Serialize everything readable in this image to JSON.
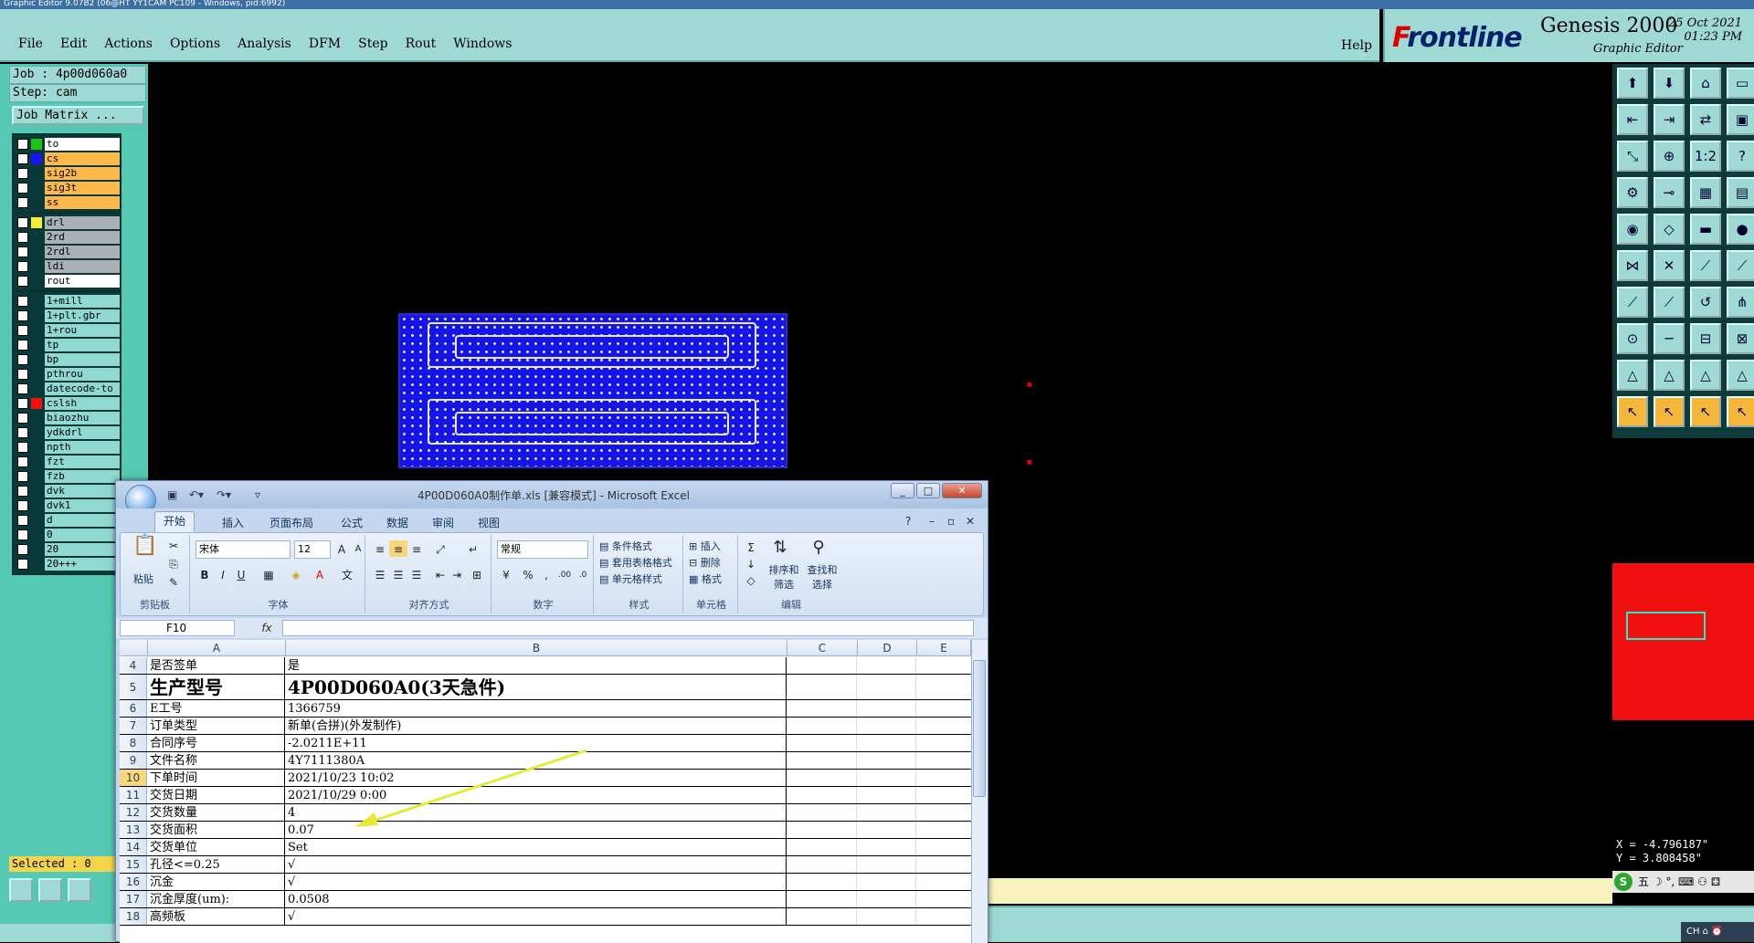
{
  "window_title": "Graphic Editor 9.07B2 (06@HT YY1CAM PC109 - Windows, pid:6992)",
  "menu": [
    "File",
    "Edit",
    "Actions",
    "Options",
    "Analysis",
    "DFM",
    "Step",
    "Rout",
    "Windows"
  ],
  "help": "Help",
  "brand": {
    "logo_f": "F",
    "logo_rest": "rontline",
    "title": "Genesis 2000",
    "subtitle": "Graphic Editor",
    "date": "25 Oct 2021",
    "time": "01:23 PM"
  },
  "job": "Job : 4p00d060a0",
  "step": "Step: cam",
  "job_matrix": "Job Matrix ...",
  "layers_board": [
    {
      "name": "to",
      "color": "#1cc41c",
      "kind": "top"
    },
    {
      "name": "cs",
      "color": "#1616f0",
      "kind": "board"
    },
    {
      "name": "sig2b",
      "color": "",
      "kind": "board"
    },
    {
      "name": "sig3t",
      "color": "",
      "kind": "board"
    },
    {
      "name": "ss",
      "color": "",
      "kind": "board"
    }
  ],
  "layers_drill": [
    {
      "name": "drl",
      "color": "#f5ef3c",
      "kind": "drill"
    },
    {
      "name": "2rd",
      "color": "",
      "kind": "drill"
    },
    {
      "name": "2rdl",
      "color": "",
      "kind": "drill"
    },
    {
      "name": "ldi",
      "color": "",
      "kind": "drill"
    },
    {
      "name": "rout",
      "color": "",
      "kind": "drillw"
    }
  ],
  "layers_misc": [
    {
      "name": "1+mill",
      "color": ""
    },
    {
      "name": "1+plt.gbr",
      "color": ""
    },
    {
      "name": "1+rou",
      "color": ""
    },
    {
      "name": "tp",
      "color": ""
    },
    {
      "name": "bp",
      "color": ""
    },
    {
      "name": "pthrou",
      "color": ""
    },
    {
      "name": "datecode-to",
      "color": ""
    },
    {
      "name": "cslsh",
      "color": "#f01010"
    },
    {
      "name": "biaozhu",
      "color": ""
    },
    {
      "name": "ydkdrl",
      "color": ""
    },
    {
      "name": "npth",
      "color": ""
    },
    {
      "name": "fzt",
      "color": ""
    },
    {
      "name": "fzb",
      "color": ""
    },
    {
      "name": "dvk",
      "color": ""
    },
    {
      "name": "dvk1",
      "color": ""
    },
    {
      "name": "d",
      "color": ""
    },
    {
      "name": "0",
      "color": ""
    },
    {
      "name": "20",
      "color": ""
    },
    {
      "name": "20+++",
      "color": ""
    }
  ],
  "selected": "Selected : 0",
  "coords": {
    "x": "X = -4.796187\"",
    "y": "Y = 3.808458\""
  },
  "ime": "五 ☽ °, ⌨ ⚇ ⚃",
  "tray": "CH ⌂ ⏰",
  "excel": {
    "title": "4P00D060A0制作单.xls [兼容模式] - Microsoft Excel",
    "tabs": [
      "开始",
      "插入",
      "页面布局",
      "公式",
      "数据",
      "审阅",
      "视图"
    ],
    "groups": {
      "clipboard": "剪贴板",
      "font": "字体",
      "align": "对齐方式",
      "number": "数字",
      "style": "样式",
      "cells": "单元格",
      "edit": "编辑"
    },
    "paste": "粘贴",
    "font_name": "宋体",
    "font_size": "12",
    "number_format": "常规",
    "style_items": [
      "条件格式",
      "套用表格格式",
      "单元格样式"
    ],
    "cell_items": [
      "插入",
      "删除",
      "格式"
    ],
    "edit_items": [
      "排序和筛选",
      "查找和选择"
    ],
    "name_box": "F10",
    "fx": "fx",
    "columns": [
      "A",
      "B",
      "C",
      "D",
      "E"
    ],
    "rows": [
      {
        "n": "4",
        "a": "是否签单",
        "b": "是"
      },
      {
        "n": "5",
        "a": "生产型号",
        "b": "4P00D060A0(3天急件)",
        "big": true
      },
      {
        "n": "6",
        "a": "E工号",
        "b": "1366759"
      },
      {
        "n": "7",
        "a": "订单类型",
        "b": "新单(合拼)(外发制作)"
      },
      {
        "n": "8",
        "a": "合同序号",
        "b": "-2.0211E+11"
      },
      {
        "n": "9",
        "a": "文件名称",
        "b": "4Y7111380A"
      },
      {
        "n": "10",
        "a": "下单时间",
        "b": "2021/10/23 10:02"
      },
      {
        "n": "11",
        "a": "交货日期",
        "b": "2021/10/29 0:00"
      },
      {
        "n": "12",
        "a": "交货数量",
        "b": "4"
      },
      {
        "n": "13",
        "a": "交货面积",
        "b": "0.07"
      },
      {
        "n": "14",
        "a": "交货单位",
        "b": "Set"
      },
      {
        "n": "15",
        "a": "孔径<=0.25",
        "b": "√"
      },
      {
        "n": "16",
        "a": "沉金",
        "b": "√"
      },
      {
        "n": "17",
        "a": "沉金厚度(um):",
        "b": "0.0508"
      },
      {
        "n": "18",
        "a": "高频板",
        "b": "√"
      }
    ]
  }
}
